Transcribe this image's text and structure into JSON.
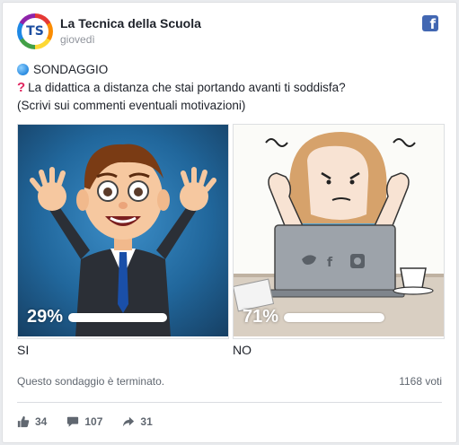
{
  "header": {
    "avatar_text": "TS",
    "page_name": "La Tecnica della Scuola",
    "post_time": "giovedì",
    "platform_icon": "f"
  },
  "post": {
    "line1": "SONDAGGIO",
    "line2": "La didattica a distanza che stai portando avanti ti soddisfa?",
    "line3": "(Scrivi sui commenti eventuali motivazioni)"
  },
  "poll": {
    "options": [
      {
        "label": "SI",
        "percent_text": "29%",
        "percent": 29
      },
      {
        "label": "NO",
        "percent_text": "71%",
        "percent": 71
      }
    ],
    "status": "Questo sondaggio è terminato.",
    "votes": "1168 voti"
  },
  "stats": {
    "likes": "34",
    "comments": "107",
    "shares": "31"
  },
  "colors": {
    "facebook_blue": "#4267b2",
    "text_gray": "#606770"
  }
}
